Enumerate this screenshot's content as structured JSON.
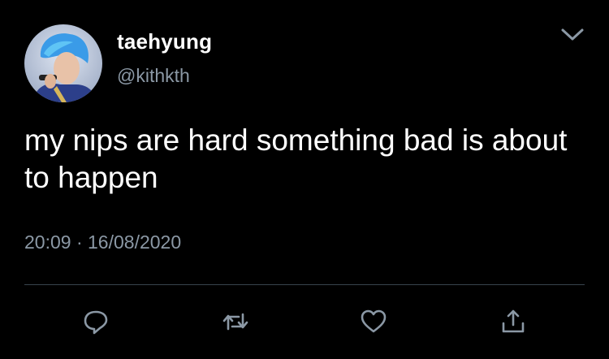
{
  "tweet": {
    "display_name": "taehyung",
    "handle": "@kithkth",
    "text": "my nips are hard something bad is about to happen",
    "time": "20:09",
    "separator": "·",
    "date": "16/08/2020"
  },
  "icons": {
    "more": "chevron-down-icon",
    "reply": "reply-icon",
    "retweet": "retweet-icon",
    "like": "heart-icon",
    "share": "share-icon"
  },
  "colors": {
    "background": "#000000",
    "primary_text": "#ffffff",
    "secondary_text": "#8b98a5",
    "divider": "#38444d"
  }
}
